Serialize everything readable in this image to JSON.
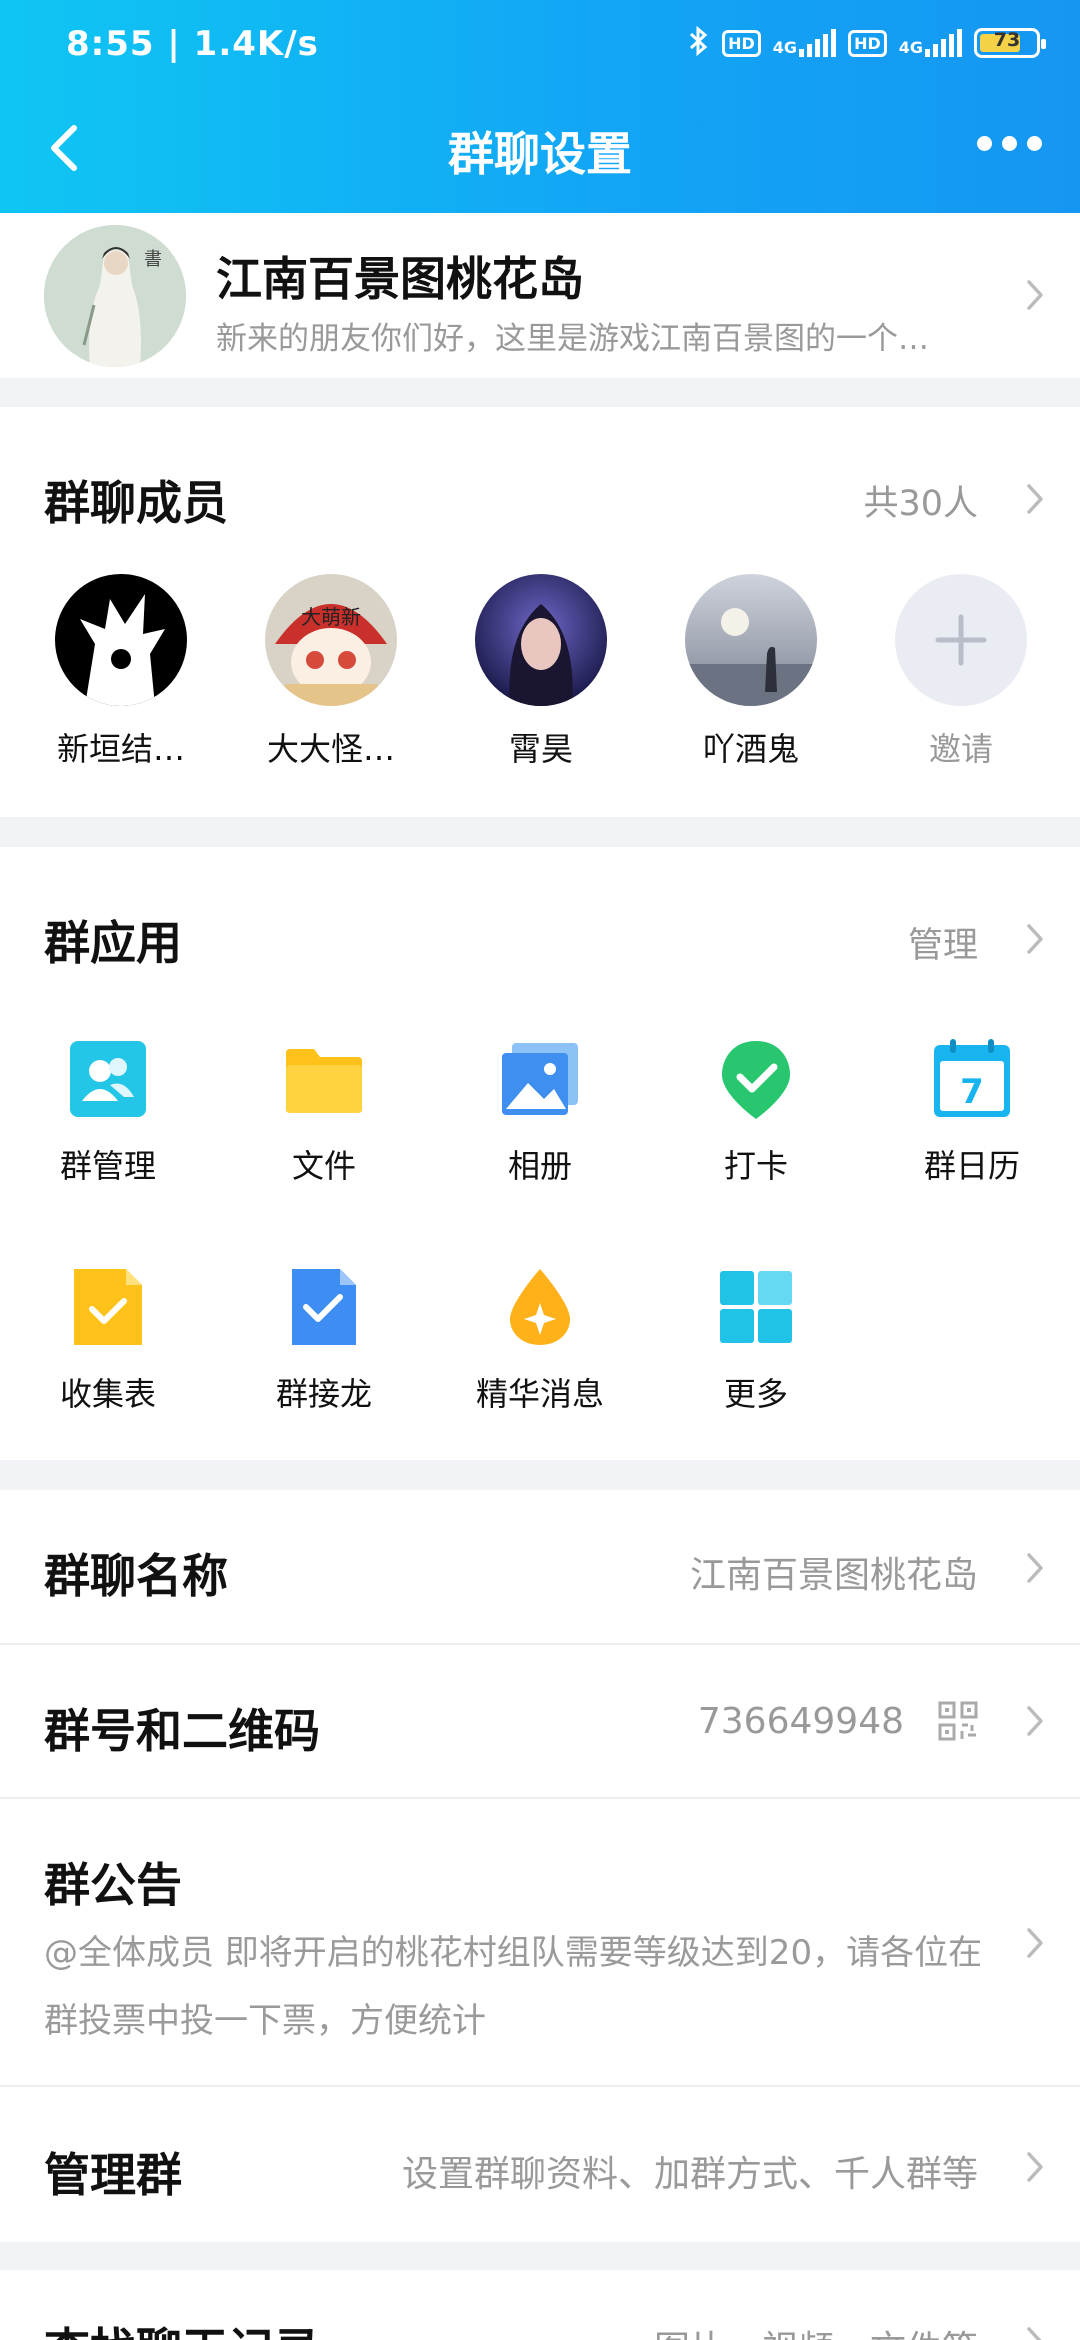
{
  "status_bar": {
    "time": "8:55 | 1.4K/s",
    "hd1": "HD",
    "hd2": "HD",
    "net1": "4G",
    "net2": "4G",
    "battery": "73"
  },
  "nav": {
    "title": "群聊设置",
    "back_icon": "chevron-left-icon",
    "more_icon": "more-dots-icon"
  },
  "group": {
    "name": "江南百景图桃花岛",
    "description": "新来的朋友你们好，这里是游戏江南百景图的一个…"
  },
  "members": {
    "title": "群聊成员",
    "count": "共30人",
    "list": [
      {
        "name": "新垣结…"
      },
      {
        "name": "大大怪…",
        "badge": "大萌新"
      },
      {
        "name": "霄昊"
      },
      {
        "name": "吖酒鬼"
      }
    ],
    "invite_label": "邀请"
  },
  "apps": {
    "title": "群应用",
    "manage": "管理",
    "items": [
      {
        "label": "群管理",
        "icon": "group-manage-icon"
      },
      {
        "label": "文件",
        "icon": "folder-icon"
      },
      {
        "label": "相册",
        "icon": "album-icon"
      },
      {
        "label": "打卡",
        "icon": "check-in-icon"
      },
      {
        "label": "群日历",
        "icon": "calendar-icon",
        "day": "7"
      },
      {
        "label": "收集表",
        "icon": "form-icon"
      },
      {
        "label": "群接龙",
        "icon": "solitaire-icon"
      },
      {
        "label": "精华消息",
        "icon": "essence-icon"
      },
      {
        "label": "更多",
        "icon": "more-apps-icon"
      }
    ]
  },
  "settings": {
    "group_name_label": "群聊名称",
    "group_name_value": "江南百景图桃花岛",
    "group_id_label": "群号和二维码",
    "group_id_value": "736649948",
    "notice_label": "群公告",
    "notice_text": "@全体成员 即将开启的桃花村组队需要等级达到20，请各位在群投票中投一下票，方便统计",
    "manage_label": "管理群",
    "manage_value": "设置群聊资料、加群方式、千人群等",
    "search_label": "查找聊天记录",
    "search_value": "图片、视频、文件等"
  },
  "colors": {
    "header_start": "#0fc6f3",
    "header_end": "#1596f2",
    "background": "#f2f3f7",
    "secondary_text": "#999999"
  }
}
